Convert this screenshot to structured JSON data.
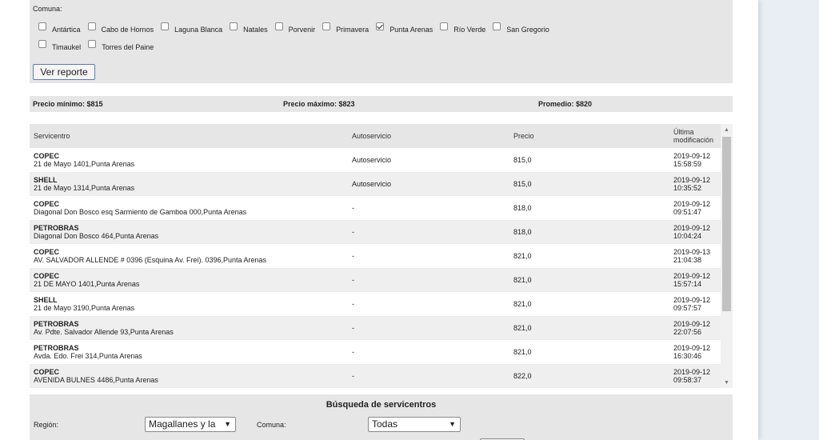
{
  "filter": {
    "comuna_label": "Comuna:",
    "checkboxes_row1": [
      {
        "label": "Antártica",
        "checked": false
      },
      {
        "label": "Cabo de Hornos",
        "checked": false
      },
      {
        "label": "Laguna Blanca",
        "checked": false
      },
      {
        "label": "Natales",
        "checked": false
      },
      {
        "label": "Porvenir",
        "checked": false
      },
      {
        "label": "Primavera",
        "checked": false
      },
      {
        "label": "Punta Arenas",
        "checked": true
      },
      {
        "label": "Río Verde",
        "checked": false
      },
      {
        "label": "San Gregorio",
        "checked": false
      }
    ],
    "checkboxes_row2": [
      {
        "label": "Timaukel",
        "checked": false
      },
      {
        "label": "Torres del Paine",
        "checked": false
      }
    ],
    "button_label": "Ver reporte"
  },
  "stats": {
    "min": "Precio mínimo: $815",
    "max": "Precio máximo: $823",
    "avg": "Promedio: $820"
  },
  "table": {
    "headers": {
      "servicentro": "Servicentro",
      "autoservicio": "Autoservicio",
      "precio": "Precio",
      "ultima_l1": "Última",
      "ultima_l2": "modificación"
    },
    "rows": [
      {
        "name": "COPEC",
        "address": "21 de Mayo 1401,Punta Arenas",
        "auto": "Autoservicio",
        "price": "815,0",
        "date": "2019-09-12",
        "time": "15:58:59"
      },
      {
        "name": "SHELL",
        "address": "21 de Mayo 1314,Punta Arenas",
        "auto": "Autoservicio",
        "price": "815,0",
        "date": "2019-09-12",
        "time": "10:35:52"
      },
      {
        "name": "COPEC",
        "address": "Diagonal Don Bosco esq Sarmiento de Gamboa 000,Punta Arenas",
        "auto": "-",
        "price": "818,0",
        "date": "2019-09-12",
        "time": "09:51:47"
      },
      {
        "name": "PETROBRAS",
        "address": "Diagonal Don Bosco 464,Punta Arenas",
        "auto": "-",
        "price": "818,0",
        "date": "2019-09-12",
        "time": "10:04:24"
      },
      {
        "name": "COPEC",
        "address": "AV. SALVADOR ALLENDE # 0396 (Esquina Av. Frei). 0396,Punta Arenas",
        "auto": "-",
        "price": "821,0",
        "date": "2019-09-13",
        "time": "21:04:38"
      },
      {
        "name": "COPEC",
        "address": "21 DE MAYO 1401,Punta Arenas",
        "auto": "-",
        "price": "821,0",
        "date": "2019-09-12",
        "time": "15:57:14"
      },
      {
        "name": "SHELL",
        "address": "21 de Mayo 3190,Punta Arenas",
        "auto": "-",
        "price": "821,0",
        "date": "2019-09-12",
        "time": "09:57:57"
      },
      {
        "name": "PETROBRAS",
        "address": "Av. Pdte. Salvador Allende 93,Punta Arenas",
        "auto": "-",
        "price": "821,0",
        "date": "2019-09-12",
        "time": "22:07:56"
      },
      {
        "name": "PETROBRAS",
        "address": "Avda. Edo. Frei 314,Punta Arenas",
        "auto": "-",
        "price": "821,0",
        "date": "2019-09-12",
        "time": "16:30:46"
      },
      {
        "name": "COPEC",
        "address": "AVENIDA BULNES 4486,Punta Arenas",
        "auto": "-",
        "price": "822,0",
        "date": "2019-09-12",
        "time": "09:58:37"
      }
    ]
  },
  "search": {
    "title": "Búsqueda de servicentros",
    "region_label": "Región:",
    "region_value": "Magallanes y la",
    "comuna_label": "Comuna:",
    "comuna_value": "Todas"
  },
  "icons": {
    "check": "checkmark-icon",
    "dropdown": "chevron-down-icon",
    "scroll_up": "arrow-up-icon",
    "scroll_down": "arrow-down-icon"
  },
  "colors": {
    "panel_bg": "#e6e6e6",
    "row_alt": "#efefef",
    "button_border": "#5a7cb0",
    "outer_bg": "#e8eef3"
  }
}
